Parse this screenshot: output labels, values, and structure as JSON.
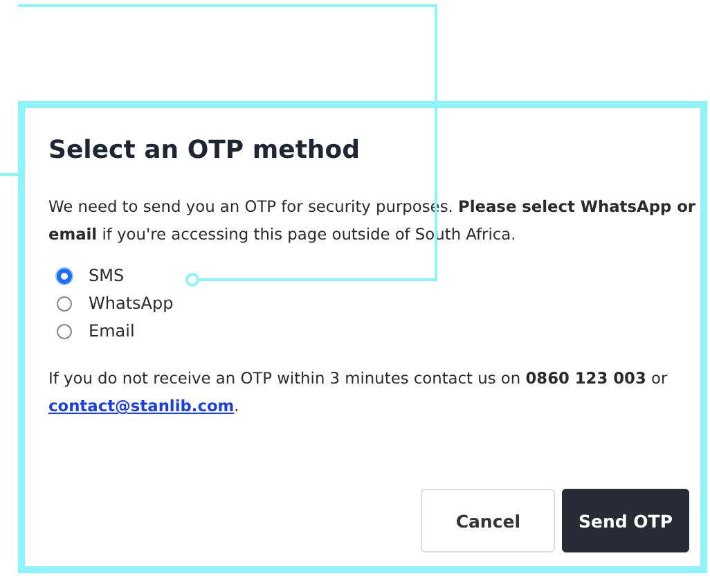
{
  "dialog": {
    "title": "Select an OTP method",
    "intro": "We need to send you an OTP for security purposes. **Please select WhatsApp or email** if you're accessing this page outside of South Africa.",
    "options": [
      {
        "label": "SMS",
        "selected": true
      },
      {
        "label": "WhatsApp",
        "selected": false
      },
      {
        "label": "Email",
        "selected": false
      }
    ],
    "contact": {
      "text": "If you do not receive an OTP within 3 minutes contact us on **0860 123 003** or ",
      "email": "contact@stanlib.com",
      "end": "."
    },
    "buttons": [
      {
        "label": "Cancel",
        "kind": "secondary"
      },
      {
        "label": "Send OTP",
        "kind": "primary"
      }
    ]
  }
}
